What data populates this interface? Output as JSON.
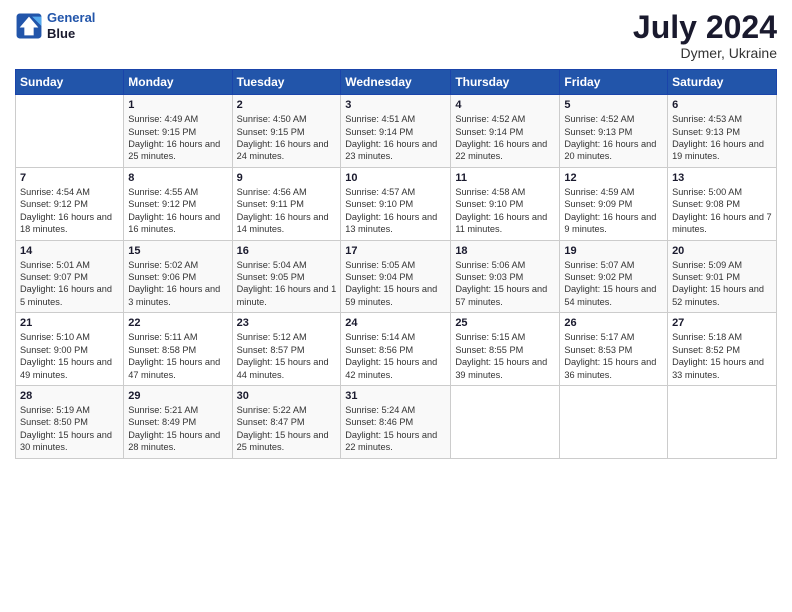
{
  "header": {
    "logo_line1": "General",
    "logo_line2": "Blue",
    "title": "July 2024",
    "location": "Dymer, Ukraine"
  },
  "days_of_week": [
    "Sunday",
    "Monday",
    "Tuesday",
    "Wednesday",
    "Thursday",
    "Friday",
    "Saturday"
  ],
  "weeks": [
    [
      {
        "num": "",
        "info": ""
      },
      {
        "num": "1",
        "info": "Sunrise: 4:49 AM\nSunset: 9:15 PM\nDaylight: 16 hours\nand 25 minutes."
      },
      {
        "num": "2",
        "info": "Sunrise: 4:50 AM\nSunset: 9:15 PM\nDaylight: 16 hours\nand 24 minutes."
      },
      {
        "num": "3",
        "info": "Sunrise: 4:51 AM\nSunset: 9:14 PM\nDaylight: 16 hours\nand 23 minutes."
      },
      {
        "num": "4",
        "info": "Sunrise: 4:52 AM\nSunset: 9:14 PM\nDaylight: 16 hours\nand 22 minutes."
      },
      {
        "num": "5",
        "info": "Sunrise: 4:52 AM\nSunset: 9:13 PM\nDaylight: 16 hours\nand 20 minutes."
      },
      {
        "num": "6",
        "info": "Sunrise: 4:53 AM\nSunset: 9:13 PM\nDaylight: 16 hours\nand 19 minutes."
      }
    ],
    [
      {
        "num": "7",
        "info": "Sunrise: 4:54 AM\nSunset: 9:12 PM\nDaylight: 16 hours\nand 18 minutes."
      },
      {
        "num": "8",
        "info": "Sunrise: 4:55 AM\nSunset: 9:12 PM\nDaylight: 16 hours\nand 16 minutes."
      },
      {
        "num": "9",
        "info": "Sunrise: 4:56 AM\nSunset: 9:11 PM\nDaylight: 16 hours\nand 14 minutes."
      },
      {
        "num": "10",
        "info": "Sunrise: 4:57 AM\nSunset: 9:10 PM\nDaylight: 16 hours\nand 13 minutes."
      },
      {
        "num": "11",
        "info": "Sunrise: 4:58 AM\nSunset: 9:10 PM\nDaylight: 16 hours\nand 11 minutes."
      },
      {
        "num": "12",
        "info": "Sunrise: 4:59 AM\nSunset: 9:09 PM\nDaylight: 16 hours\nand 9 minutes."
      },
      {
        "num": "13",
        "info": "Sunrise: 5:00 AM\nSunset: 9:08 PM\nDaylight: 16 hours\nand 7 minutes."
      }
    ],
    [
      {
        "num": "14",
        "info": "Sunrise: 5:01 AM\nSunset: 9:07 PM\nDaylight: 16 hours\nand 5 minutes."
      },
      {
        "num": "15",
        "info": "Sunrise: 5:02 AM\nSunset: 9:06 PM\nDaylight: 16 hours\nand 3 minutes."
      },
      {
        "num": "16",
        "info": "Sunrise: 5:04 AM\nSunset: 9:05 PM\nDaylight: 16 hours\nand 1 minute."
      },
      {
        "num": "17",
        "info": "Sunrise: 5:05 AM\nSunset: 9:04 PM\nDaylight: 15 hours\nand 59 minutes."
      },
      {
        "num": "18",
        "info": "Sunrise: 5:06 AM\nSunset: 9:03 PM\nDaylight: 15 hours\nand 57 minutes."
      },
      {
        "num": "19",
        "info": "Sunrise: 5:07 AM\nSunset: 9:02 PM\nDaylight: 15 hours\nand 54 minutes."
      },
      {
        "num": "20",
        "info": "Sunrise: 5:09 AM\nSunset: 9:01 PM\nDaylight: 15 hours\nand 52 minutes."
      }
    ],
    [
      {
        "num": "21",
        "info": "Sunrise: 5:10 AM\nSunset: 9:00 PM\nDaylight: 15 hours\nand 49 minutes."
      },
      {
        "num": "22",
        "info": "Sunrise: 5:11 AM\nSunset: 8:58 PM\nDaylight: 15 hours\nand 47 minutes."
      },
      {
        "num": "23",
        "info": "Sunrise: 5:12 AM\nSunset: 8:57 PM\nDaylight: 15 hours\nand 44 minutes."
      },
      {
        "num": "24",
        "info": "Sunrise: 5:14 AM\nSunset: 8:56 PM\nDaylight: 15 hours\nand 42 minutes."
      },
      {
        "num": "25",
        "info": "Sunrise: 5:15 AM\nSunset: 8:55 PM\nDaylight: 15 hours\nand 39 minutes."
      },
      {
        "num": "26",
        "info": "Sunrise: 5:17 AM\nSunset: 8:53 PM\nDaylight: 15 hours\nand 36 minutes."
      },
      {
        "num": "27",
        "info": "Sunrise: 5:18 AM\nSunset: 8:52 PM\nDaylight: 15 hours\nand 33 minutes."
      }
    ],
    [
      {
        "num": "28",
        "info": "Sunrise: 5:19 AM\nSunset: 8:50 PM\nDaylight: 15 hours\nand 30 minutes."
      },
      {
        "num": "29",
        "info": "Sunrise: 5:21 AM\nSunset: 8:49 PM\nDaylight: 15 hours\nand 28 minutes."
      },
      {
        "num": "30",
        "info": "Sunrise: 5:22 AM\nSunset: 8:47 PM\nDaylight: 15 hours\nand 25 minutes."
      },
      {
        "num": "31",
        "info": "Sunrise: 5:24 AM\nSunset: 8:46 PM\nDaylight: 15 hours\nand 22 minutes."
      },
      {
        "num": "",
        "info": ""
      },
      {
        "num": "",
        "info": ""
      },
      {
        "num": "",
        "info": ""
      }
    ]
  ]
}
